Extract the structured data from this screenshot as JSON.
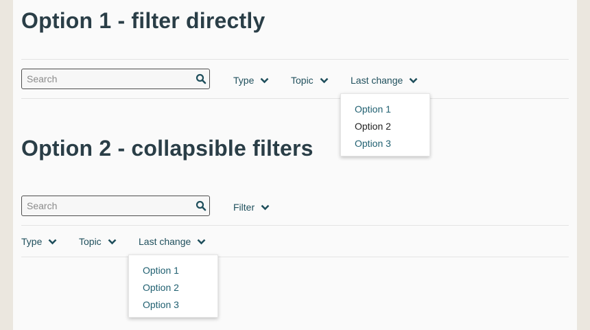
{
  "section1": {
    "title": "Option 1 - filter directly",
    "search_placeholder": "Search",
    "filters": [
      "Type",
      "Topic",
      "Last change"
    ],
    "dropdown": [
      "Option 1",
      "Option 2",
      "Option 3"
    ]
  },
  "section2": {
    "title": "Option 2 - collapsible filters",
    "search_placeholder": "Search",
    "filter_toggle": "Filter",
    "filters": [
      "Type",
      "Topic",
      "Last change"
    ],
    "dropdown": [
      "Option 1",
      "Option 2",
      "Option 3"
    ]
  },
  "icons": {
    "search": "search-icon",
    "chevron": "chevron-down-icon"
  },
  "colors": {
    "heading": "#2a3e47",
    "link": "#1f4f5c",
    "option_active": "#1f5f70",
    "option_plain": "#222222"
  }
}
